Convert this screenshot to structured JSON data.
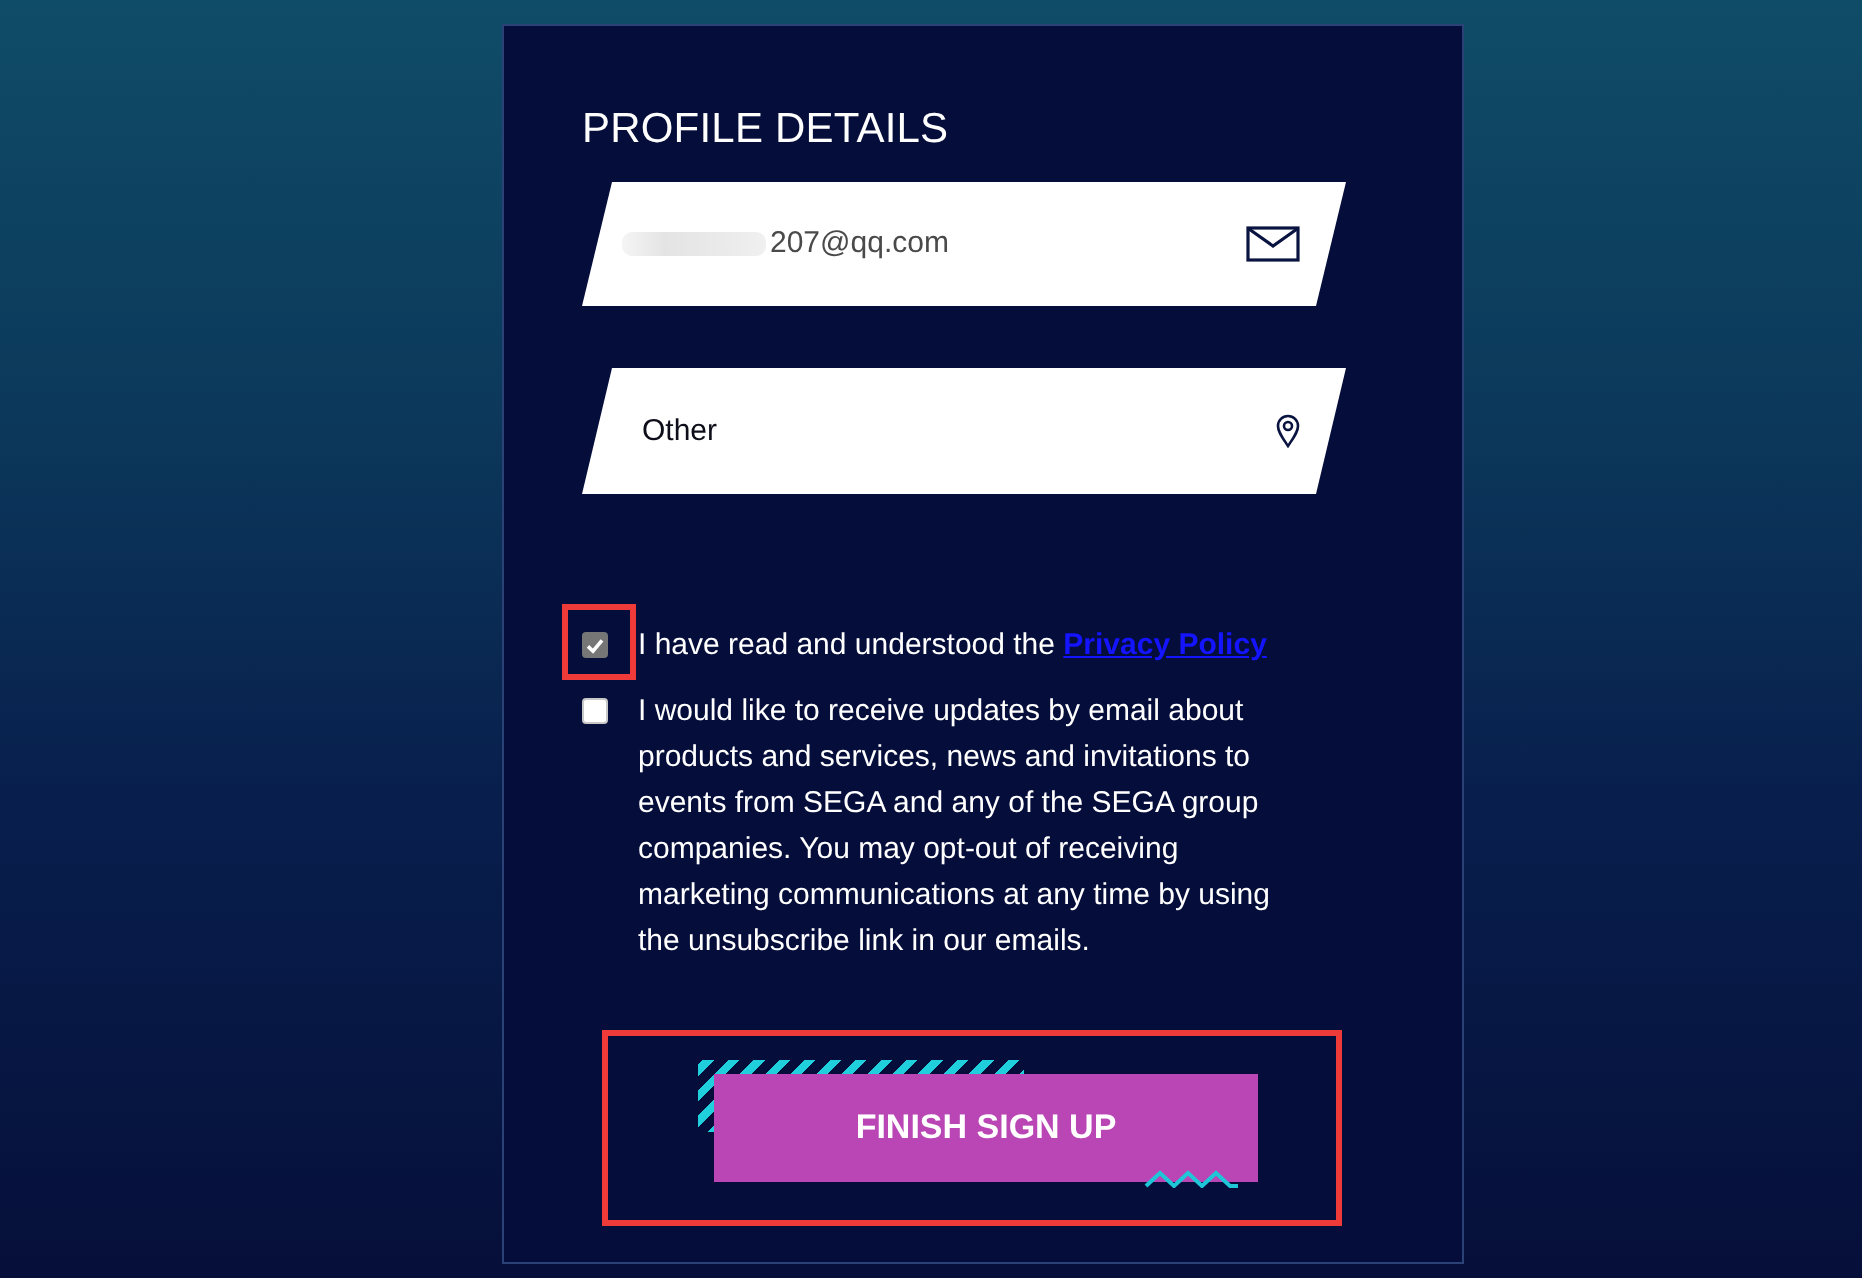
{
  "form": {
    "title": "PROFILE DETAILS"
  },
  "fields": [
    {
      "kind": "email",
      "value": "207@qq.com",
      "redacted": true
    },
    {
      "kind": "location",
      "value": "Other",
      "redacted": false
    }
  ],
  "consents": [
    {
      "checked": true,
      "highlighted": true,
      "text": "I have read and understood the ",
      "link": "Privacy Policy"
    },
    {
      "checked": false,
      "highlighted": false,
      "text": "I would like to receive updates by email about products and services, news and invitations to events from SEGA and any of the SEGA group companies. You may opt-out of receiving marketing communications at any time by using the unsubscribe link in our emails."
    }
  ],
  "submit": {
    "label": "FINISH SIGN UP",
    "highlighted": true
  }
}
